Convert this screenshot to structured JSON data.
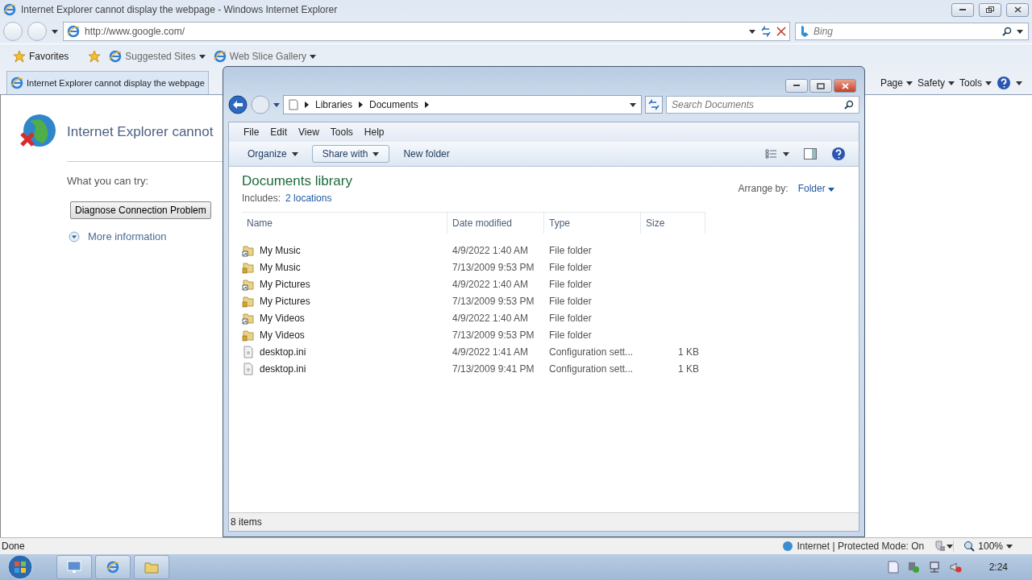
{
  "browser": {
    "title": "Internet Explorer cannot display the webpage - Windows Internet Explorer",
    "address": "http://www.google.com/",
    "search_placeholder": "Bing",
    "favorites": {
      "label": "Favorites",
      "links": [
        "Suggested Sites",
        "Web Slice Gallery"
      ]
    },
    "tab": "Internet Explorer cannot display the webpage",
    "commands": [
      "Page",
      "Safety",
      "Tools"
    ],
    "page": {
      "heading": "Internet Explorer cannot",
      "try_label": "What you can try:",
      "diagnose_button": "Diagnose Connection Problem",
      "more_info": "More information"
    },
    "status": "Done",
    "zone": "Internet | Protected Mode: On",
    "zoom": "100%"
  },
  "explorer": {
    "breadcrumb": [
      "Libraries",
      "Documents"
    ],
    "search_placeholder": "Search Documents",
    "menu": [
      "File",
      "Edit",
      "View",
      "Tools",
      "Help"
    ],
    "toolbar": [
      {
        "label": "Organize",
        "hovered": false
      },
      {
        "label": "Share with",
        "hovered": true
      }
    ],
    "new_folder": "New folder",
    "library_title": "Documents library",
    "includes_label": "Includes:",
    "includes_link": "2 locations",
    "arrange_label": "Arrange by:",
    "arrange_value": "Folder",
    "columns": [
      "Name",
      "Date modified",
      "Type",
      "Size"
    ],
    "rows": [
      {
        "kind": "shortcut",
        "name": "My Music",
        "date": "4/9/2022 1:40 AM",
        "type": "File folder",
        "size": ""
      },
      {
        "kind": "locked",
        "name": "My Music",
        "date": "7/13/2009 9:53 PM",
        "type": "File folder",
        "size": ""
      },
      {
        "kind": "shortcut",
        "name": "My Pictures",
        "date": "4/9/2022 1:40 AM",
        "type": "File folder",
        "size": ""
      },
      {
        "kind": "locked",
        "name": "My Pictures",
        "date": "7/13/2009 9:53 PM",
        "type": "File folder",
        "size": ""
      },
      {
        "kind": "shortcut",
        "name": "My Videos",
        "date": "4/9/2022 1:40 AM",
        "type": "File folder",
        "size": ""
      },
      {
        "kind": "locked",
        "name": "My Videos",
        "date": "7/13/2009 9:53 PM",
        "type": "File folder",
        "size": ""
      },
      {
        "kind": "file",
        "name": "desktop.ini",
        "date": "4/9/2022 1:41 AM",
        "type": "Configuration sett...",
        "size": "1 KB"
      },
      {
        "kind": "file",
        "name": "desktop.ini",
        "date": "7/13/2009 9:41 PM",
        "type": "Configuration sett...",
        "size": "1 KB"
      }
    ],
    "status": "8 items"
  },
  "taskbar": {
    "clock": "2:24"
  }
}
